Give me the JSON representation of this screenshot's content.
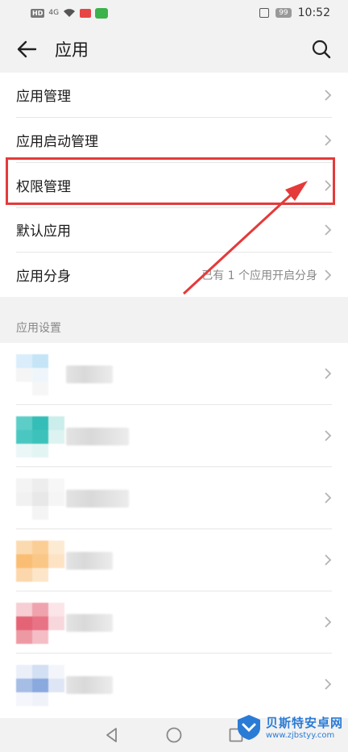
{
  "status_bar": {
    "hd": "HD",
    "signal": "4G",
    "battery": "99",
    "time": "10:52"
  },
  "header": {
    "title": "应用",
    "back_icon": "back-arrow-icon",
    "search_icon": "search-icon"
  },
  "menu": {
    "items": [
      {
        "label": "应用管理",
        "value": ""
      },
      {
        "label": "应用启动管理",
        "value": ""
      },
      {
        "label": "权限管理",
        "value": ""
      },
      {
        "label": "默认应用",
        "value": ""
      },
      {
        "label": "应用分身",
        "value": "已有 1 个应用开启分身"
      }
    ]
  },
  "annotation": {
    "highlight_color": "#e43a3a"
  },
  "section": {
    "title": "应用设置"
  },
  "apps": [
    {
      "colors": [
        "#d6ecfa",
        "#bfe3f7",
        "#ffffff",
        "#f4f4f4",
        "#eef6fb",
        "#ffffff",
        "#ffffff",
        "#f6f6f6",
        "#ffffff"
      ]
    },
    {
      "colors": [
        "#4cc9c1",
        "#1fb8b0",
        "#c6ece9",
        "#37c2ba",
        "#29bcb4",
        "#d9f2f0",
        "#e8f7f6",
        "#dff4f2",
        "#ffffff"
      ]
    },
    {
      "colors": [
        "#f3f3f3",
        "#ececec",
        "#f7f7f7",
        "#f0f0f0",
        "#e6e6e6",
        "#f5f5f5",
        "#ffffff",
        "#f3f3f3",
        "#ffffff"
      ]
    },
    {
      "colors": [
        "#fbd7a8",
        "#fbc98a",
        "#fde8cf",
        "#f9b865",
        "#fac27a",
        "#fde0bd",
        "#fbd3a3",
        "#fce3c4",
        "#ffffff"
      ]
    },
    {
      "colors": [
        "#f6c9cf",
        "#ee9aa5",
        "#fbe3e6",
        "#e25468",
        "#e66478",
        "#f7d3d8",
        "#ec8f9b",
        "#f3b8c1",
        "#ffffff"
      ]
    },
    {
      "colors": [
        "#e8eef8",
        "#cfdcf1",
        "#f2f5fb",
        "#9db7e3",
        "#7ea0dc",
        "#dbe4f4",
        "#f4f6fb",
        "#eef2f9",
        "#ffffff"
      ]
    }
  ],
  "nav": {
    "back": "nav-back-icon",
    "home": "nav-home-icon",
    "recent": "nav-recent-icon"
  },
  "watermark": {
    "name": "贝斯特安卓网",
    "url": "www.zjbstyy.com"
  }
}
